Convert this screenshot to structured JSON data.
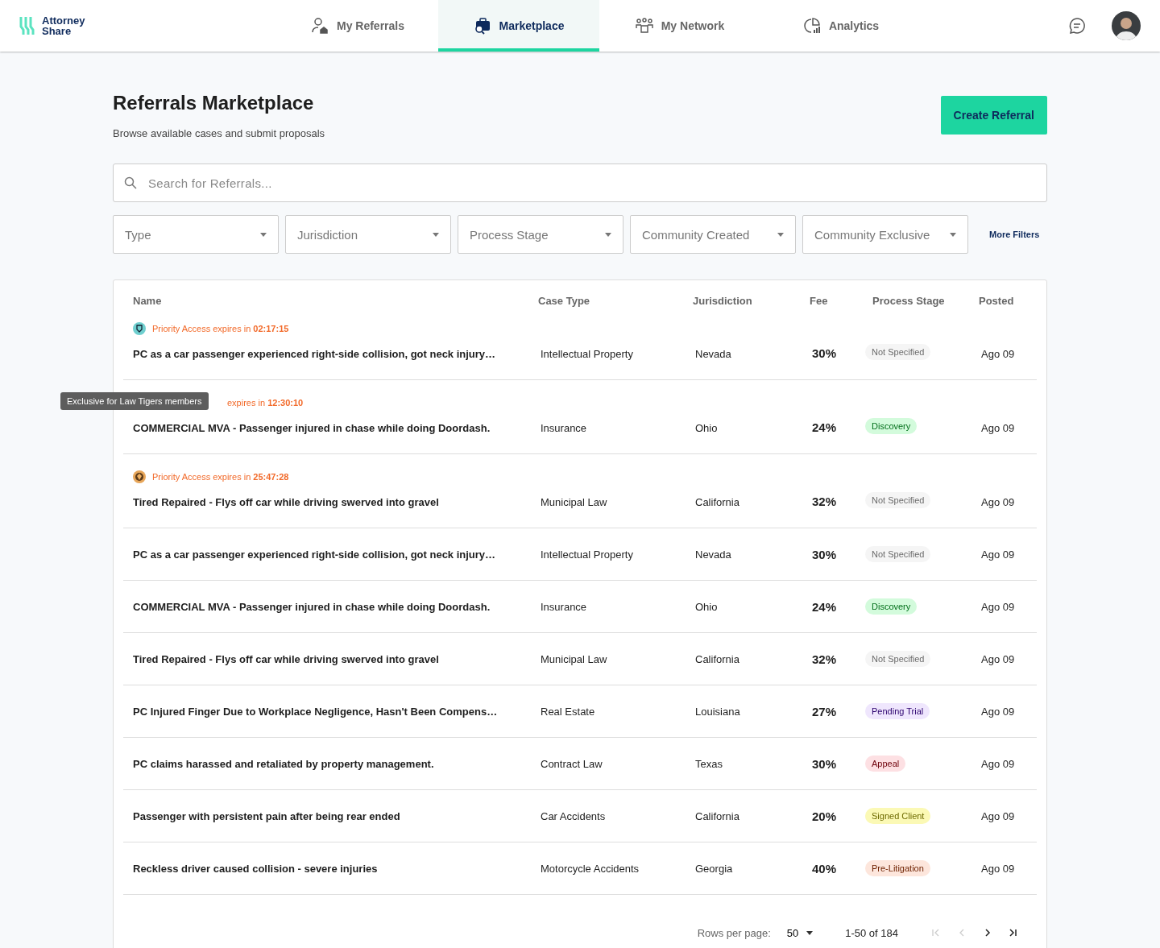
{
  "brand": {
    "line1": "Attorney",
    "line2": "Share"
  },
  "nav": [
    {
      "label": "My Referrals",
      "selected": false
    },
    {
      "label": "Marketplace",
      "selected": true
    },
    {
      "label": "My Network",
      "selected": false
    },
    {
      "label": "Analytics",
      "selected": false
    }
  ],
  "page": {
    "title": "Referrals Marketplace",
    "subtitle": "Browse available cases and submit proposals",
    "create_button": "Create Referral"
  },
  "search": {
    "placeholder": "Search for Referrals..."
  },
  "filters": [
    "Type",
    "Jurisdiction",
    "Process Stage",
    "Community Created",
    "Community Exclusive"
  ],
  "more_filters": "More Filters",
  "table": {
    "columns": [
      "Name",
      "Case Type",
      "Jurisdiction",
      "Fee",
      "Process Stage",
      "Posted"
    ],
    "rows": [
      {
        "priority": {
          "kind": "shield",
          "text": "Priority Access expires in ",
          "time": "02:17:15",
          "covered": false
        },
        "name": "PC as a car passenger experienced right-side collision, got neck injury…",
        "case_type": "Intellectual Property",
        "jurisdiction": "Nevada",
        "fee": "30%",
        "stage": "Not Specified",
        "color": "#f5f5f5",
        "posted": "Ago 09"
      },
      {
        "priority": {
          "text": "expires in ",
          "time": "12:30:10",
          "covered": true
        },
        "name": "COMMERCIAL MVA - Passenger injured in chase while doing Doordash.",
        "case_type": "Insurance",
        "jurisdiction": "Ohio",
        "fee": "24%",
        "stage": "Discovery",
        "color": "#d3fbdc",
        "posted": "Ago 09"
      },
      {
        "priority": {
          "kind": "emblem",
          "text": "Priority Access expires in ",
          "time": "25:47:28",
          "covered": false
        },
        "name": "Tired Repaired - Flys off car while driving swerved into gravel",
        "case_type": "Municipal Law",
        "jurisdiction": "California",
        "fee": "32%",
        "stage": "Not Specified",
        "color": "#f5f5f5",
        "posted": "Ago 09"
      },
      {
        "name": "PC as a car passenger experienced right-side collision, got neck injury…",
        "case_type": "Intellectual Property",
        "jurisdiction": "Nevada",
        "fee": "30%",
        "stage": "Not Specified",
        "color": "#f5f5f5",
        "posted": "Ago 09"
      },
      {
        "name": "COMMERCIAL MVA - Passenger injured in chase while doing Doordash.",
        "case_type": "Insurance",
        "jurisdiction": "Ohio",
        "fee": "24%",
        "stage": "Discovery",
        "color": "#d3fbdc",
        "posted": "Ago 09"
      },
      {
        "name": "Tired Repaired - Flys off car while driving swerved into gravel",
        "case_type": "Municipal Law",
        "jurisdiction": "California",
        "fee": "32%",
        "stage": "Not Specified",
        "color": "#f5f5f5",
        "posted": "Ago 09"
      },
      {
        "name": "PC Injured Finger Due to Workplace Negligence, Hasn't Been Compens…",
        "case_type": "Real Estate",
        "jurisdiction": "Louisiana",
        "fee": "27%",
        "stage": "Pending Trial",
        "color": "#efe6fd",
        "posted": "Ago 09"
      },
      {
        "name": "PC claims harassed and retaliated by property management.",
        "case_type": "Contract Law",
        "jurisdiction": "Texas",
        "fee": "30%",
        "stage": "Appeal",
        "color": "#fde0e3",
        "posted": "Ago 09"
      },
      {
        "name": "Passenger with persistent pain after being rear ended",
        "case_type": "Car Accidents",
        "jurisdiction": "California",
        "fee": "20%",
        "stage": "Signed Client",
        "color": "#fbf9b5",
        "posted": "Ago 09"
      },
      {
        "name": "Reckless driver caused collision - severe injuries",
        "case_type": "Motorcycle Accidents",
        "jurisdiction": "Georgia",
        "fee": "40%",
        "stage": "Pre-Litigation",
        "color": "#fde6dc",
        "posted": "Ago 09"
      }
    ]
  },
  "tooltip": "Exclusive for Law Tigers members",
  "pagination": {
    "label": "Rows per page:",
    "rows": "50",
    "range": "1-50 of 184"
  }
}
